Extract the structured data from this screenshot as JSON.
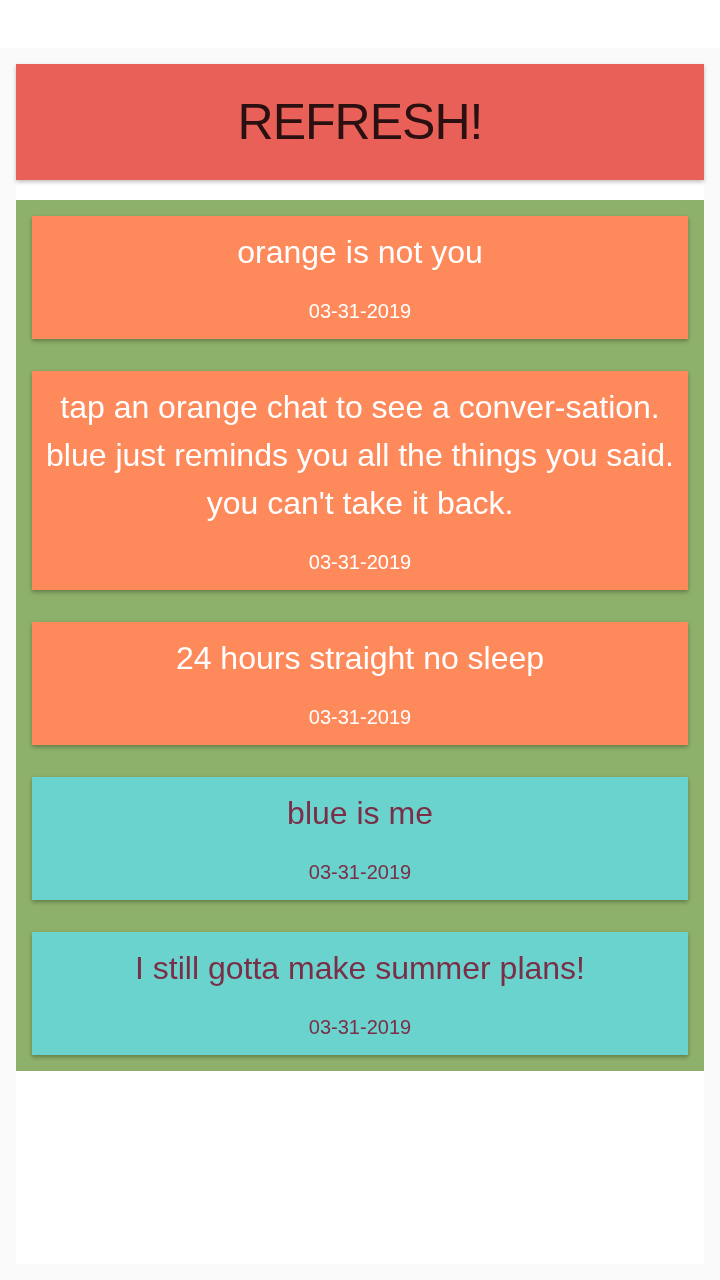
{
  "header": {
    "button": "REFRESH!"
  },
  "chats": [
    {
      "kind": "orange",
      "text": "orange is not you",
      "date": "03-31-2019"
    },
    {
      "kind": "orange",
      "text": "tap an orange chat to see a conver-sation. blue just reminds you all the things you said. you can't take it back.",
      "date": "03-31-2019"
    },
    {
      "kind": "orange",
      "text": "24 hours straight no sleep",
      "date": "03-31-2019"
    },
    {
      "kind": "blue",
      "text": "blue is me",
      "date": "03-31-2019"
    },
    {
      "kind": "blue",
      "text": "I still gotta make summer plans!",
      "date": "03-31-2019"
    }
  ]
}
